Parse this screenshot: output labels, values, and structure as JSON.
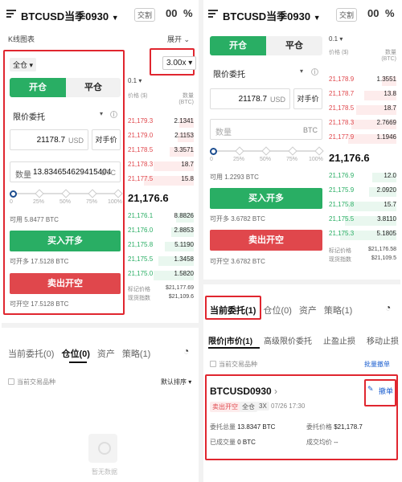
{
  "left": {
    "header": {
      "title": "BTCUSD当季0930",
      "tag": "交割",
      "icon1": "00",
      "icon2": "%"
    },
    "kline_label": "K线图表",
    "expand_label": "展开",
    "margin_mode": "全仓",
    "leverage": "3.00x",
    "tabs": {
      "open": "开仓",
      "close": "平仓"
    },
    "order_type": "限价委托",
    "price": {
      "value": "21178.7",
      "unit": "USD",
      "side_label": "对手价"
    },
    "quantity": {
      "label": "数量",
      "value": "13.834654629415404",
      "unit": "BTC"
    },
    "slider_marks": [
      "0",
      "25%",
      "50%",
      "75%",
      "100%"
    ],
    "available": "可用 5.8477 BTC",
    "buy_label": "买入开多",
    "can_open_long": "可开多 17.5128 BTC",
    "sell_label": "卖出开空",
    "can_open_short": "可开空 17.5128 BTC",
    "orderbook": {
      "depth": "0.1",
      "col_price": "价格 ($)",
      "col_qty": "数量 (BTC)",
      "asks": [
        {
          "price": "21,179.3",
          "qty": "2.1341"
        },
        {
          "price": "21,179.0",
          "qty": "2.1153"
        },
        {
          "price": "21,178.5",
          "qty": "3.3571"
        },
        {
          "price": "21,178.3",
          "qty": "18.7"
        },
        {
          "price": "21,177.5",
          "qty": "15.8"
        }
      ],
      "last_price": "21,176.6",
      "bids": [
        {
          "price": "21,176.1",
          "qty": "8.8826"
        },
        {
          "price": "21,176.0",
          "qty": "2.8853"
        },
        {
          "price": "21,175.8",
          "qty": "5.1190"
        },
        {
          "price": "21,175.5",
          "qty": "1.3458"
        },
        {
          "price": "21,175.0",
          "qty": "1.5820"
        }
      ],
      "mark_label": "标记价格",
      "mark_value": "$21,177.69",
      "index_label": "现货指数",
      "index_value": "$21,109.6"
    },
    "bottom_tabs": [
      "当前委托(0)",
      "仓位(0)",
      "资产",
      "策略(1)"
    ],
    "current_only": "当前交易品种",
    "sort": "默认排序",
    "empty_text": "暂无数据"
  },
  "right": {
    "header": {
      "title": "BTCUSD当季0930",
      "tag": "交割",
      "icon1": "00",
      "icon2": "%"
    },
    "tabs": {
      "open": "开仓",
      "close": "平仓"
    },
    "order_type": "限价委托",
    "price": {
      "value": "21178.7",
      "unit": "USD",
      "side_label": "对手价"
    },
    "quantity": {
      "placeholder": "数量",
      "unit": "BTC"
    },
    "slider_marks": [
      "0",
      "25%",
      "50%",
      "75%",
      "100%"
    ],
    "available": "可用 1.2293 BTC",
    "buy_label": "买入开多",
    "can_open_long": "可开多 3.6782 BTC",
    "sell_label": "卖出开空",
    "can_open_short": "可开空 3.6782 BTC",
    "orderbook": {
      "depth": "0.1",
      "col_price": "价格 ($)",
      "col_qty": "数量 (BTC)",
      "asks": [
        {
          "price": "21,178.9",
          "qty": "1.3551"
        },
        {
          "price": "21,178.7",
          "qty": "13.8"
        },
        {
          "price": "21,178.5",
          "qty": "18.7"
        },
        {
          "price": "21,178.3",
          "qty": "2.7669"
        },
        {
          "price": "21,177.9",
          "qty": "1.1946"
        }
      ],
      "last_price": "21,176.6",
      "bids": [
        {
          "price": "21,176.9",
          "qty": "12.0"
        },
        {
          "price": "21,175.9",
          "qty": "2.0920"
        },
        {
          "price": "21,175.8",
          "qty": "15.7"
        },
        {
          "price": "21,175.5",
          "qty": "3.8110"
        },
        {
          "price": "21,175.3",
          "qty": "5.1805"
        }
      ],
      "mark_label": "标记价格",
      "mark_value": "$21,176.58",
      "index_label": "现货指数",
      "index_value": "$21,109.5"
    },
    "bottom_tabs": [
      "当前委托(1)",
      "仓位(0)",
      "资产",
      "策略(1)"
    ],
    "sub_tabs": [
      "限价|市价(1)",
      "高级限价委托",
      "止盈止损",
      "移动止损"
    ],
    "current_only": "当前交易品种",
    "batch_cancel": "批量撤单",
    "order": {
      "symbol": "BTCUSD0930",
      "badge_side": "卖出开空",
      "badge_mode": "全仓",
      "badge_lev": "3X",
      "time": "07/26 17:30",
      "cancel": "撤单",
      "qty_label": "委托总量",
      "qty_value": "13.8347 BTC",
      "price_label": "委托价格",
      "price_value": "$21,178.7",
      "filled_label": "已成交量",
      "filled_value": "0 BTC",
      "avg_label": "成交均价",
      "avg_value": "--"
    }
  },
  "colors": {
    "green": "#29ae64",
    "red": "#e0474c",
    "highlight": "#e0262f",
    "link": "#1c5fd0"
  }
}
